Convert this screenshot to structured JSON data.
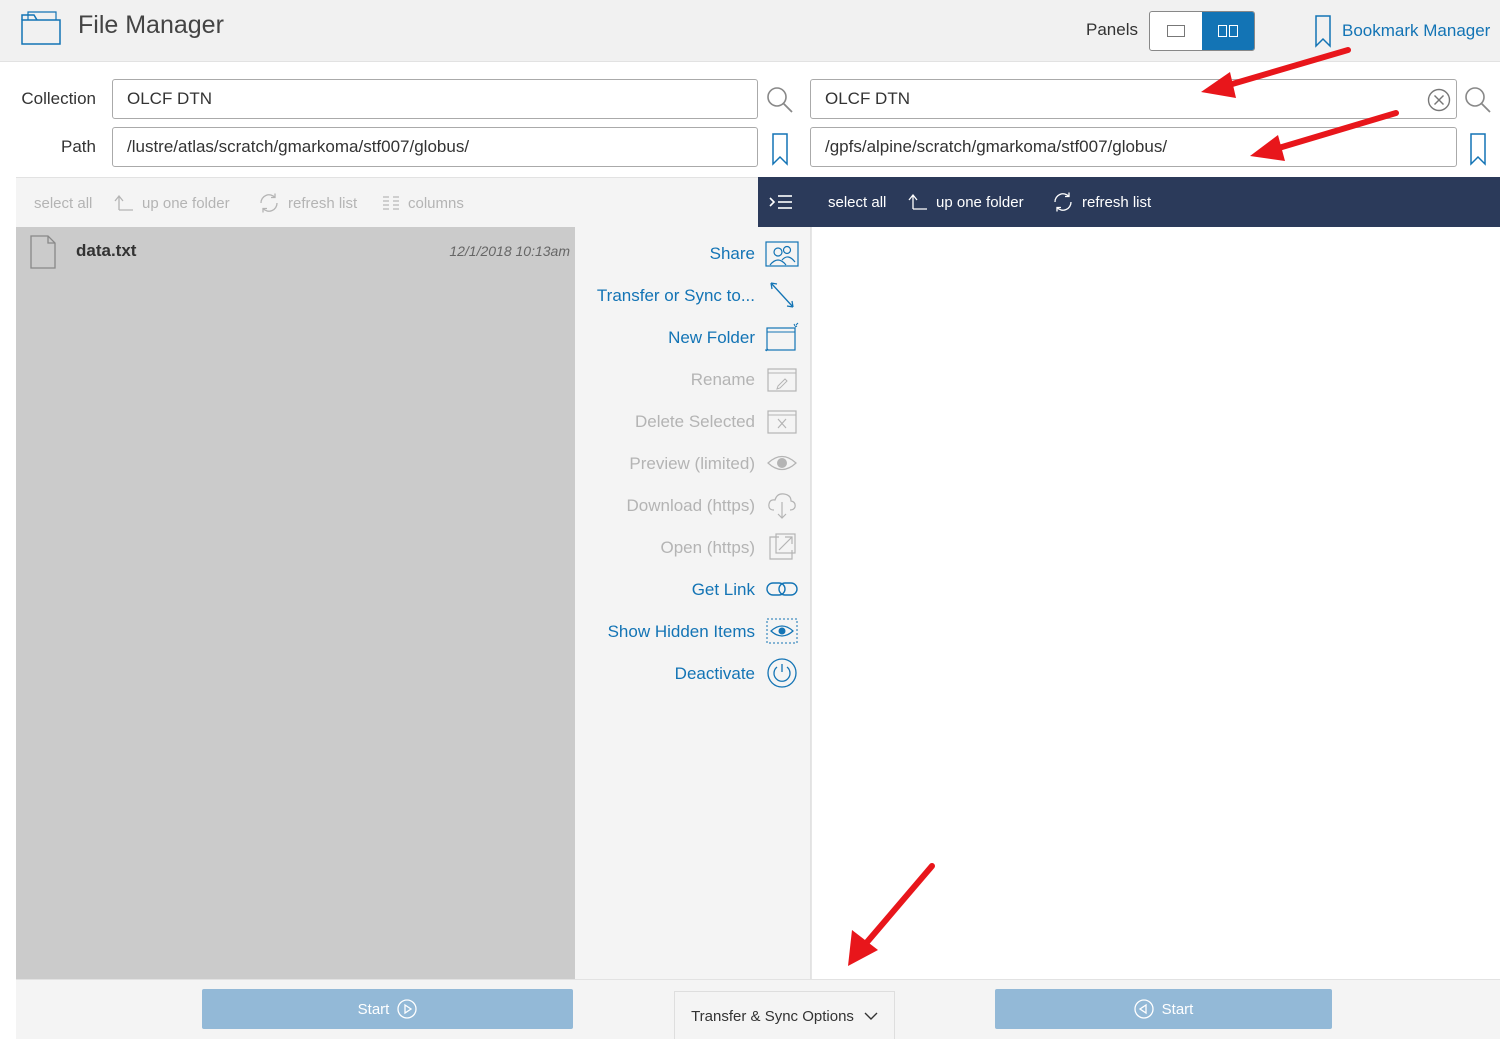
{
  "header": {
    "title": "File Manager",
    "panels_label": "Panels",
    "bookmark_manager": "Bookmark Manager"
  },
  "left": {
    "collection_label": "Collection",
    "path_label": "Path",
    "collection": "OLCF DTN",
    "path": "/lustre/atlas/scratch/gmarkoma/stf007/globus/",
    "toolbar": {
      "select_all": "select all",
      "up_one_folder": "up one folder",
      "refresh_list": "refresh list",
      "columns": "columns"
    },
    "files": [
      {
        "name": "data.txt",
        "date": "12/1/2018 10:13am"
      }
    ],
    "start": "Start"
  },
  "right": {
    "collection": "OLCF DTN",
    "path": "/gpfs/alpine/scratch/gmarkoma/stf007/globus/",
    "toolbar": {
      "select_all": "select all",
      "up_one_folder": "up one folder",
      "refresh_list": "refresh list"
    },
    "start": "Start"
  },
  "actions": [
    {
      "label": "Share",
      "enabled": true,
      "icon": "share-icon"
    },
    {
      "label": "Transfer or Sync to...",
      "enabled": true,
      "icon": "transfer-icon"
    },
    {
      "label": "New Folder",
      "enabled": true,
      "icon": "new-folder-icon"
    },
    {
      "label": "Rename",
      "enabled": false,
      "icon": "rename-icon"
    },
    {
      "label": "Delete Selected",
      "enabled": false,
      "icon": "delete-icon"
    },
    {
      "label": "Preview (limited)",
      "enabled": false,
      "icon": "preview-eye-icon"
    },
    {
      "label": "Download (https)",
      "enabled": false,
      "icon": "download-cloud-icon"
    },
    {
      "label": "Open (https)",
      "enabled": false,
      "icon": "open-external-icon"
    },
    {
      "label": "Get Link",
      "enabled": true,
      "icon": "link-icon"
    },
    {
      "label": "Show Hidden Items",
      "enabled": true,
      "icon": "show-hidden-eye-icon"
    },
    {
      "label": "Deactivate",
      "enabled": true,
      "icon": "power-icon"
    }
  ],
  "footer": {
    "transfer_sync_options": "Transfer & Sync Options"
  },
  "colors": {
    "accent_blue": "#1374b5",
    "nav_dark": "#2b3a5a",
    "start_button": "#93b9d7",
    "disabled_text": "#b4b4b4",
    "annotation_red": "#e8161b"
  }
}
